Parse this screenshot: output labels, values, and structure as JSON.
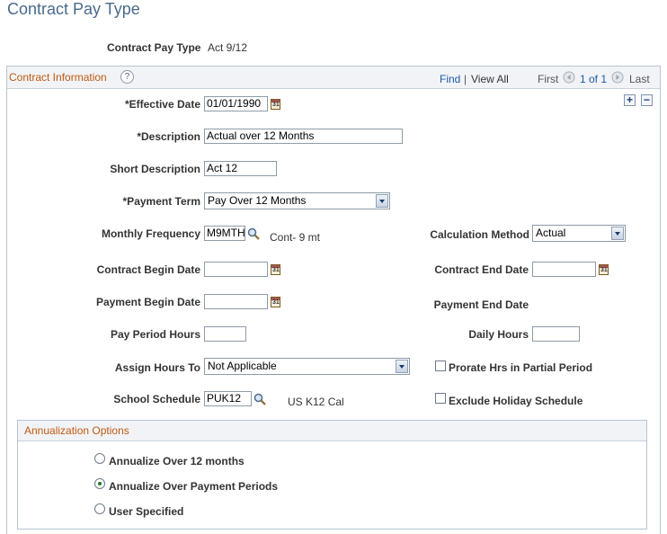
{
  "page": {
    "title": "Contract Pay Type"
  },
  "header": {
    "label": "Contract Pay Type",
    "value": "Act 9/12"
  },
  "contract_info": {
    "title": "Contract Information",
    "find": "Find",
    "sep": "|",
    "view_all": "View All",
    "first": "First",
    "range": "1 of 1",
    "last": "Last",
    "add": "+",
    "remove": "−"
  },
  "fields": {
    "effective_date": {
      "label": "*Effective Date",
      "value": "01/01/1990"
    },
    "description": {
      "label": "*Description",
      "value": "Actual over 12 Months"
    },
    "short_description": {
      "label": "Short Description",
      "value": "Act 12"
    },
    "payment_term": {
      "label": "*Payment Term",
      "value": "Pay Over 12 Months"
    },
    "monthly_frequency": {
      "label": "Monthly Frequency",
      "value": "M9MTH",
      "desc": "Cont- 9 mt"
    },
    "calculation_method": {
      "label": "Calculation Method",
      "value": "Actual"
    },
    "contract_begin_date": {
      "label": "Contract Begin Date",
      "value": ""
    },
    "contract_end_date": {
      "label": "Contract End Date",
      "value": ""
    },
    "payment_begin_date": {
      "label": "Payment Begin Date",
      "value": ""
    },
    "payment_end_date": {
      "label": "Payment End Date"
    },
    "pay_period_hours": {
      "label": "Pay Period Hours",
      "value": ""
    },
    "daily_hours": {
      "label": "Daily Hours",
      "value": ""
    },
    "assign_hours_to": {
      "label": "Assign Hours To",
      "value": "Not Applicable"
    },
    "prorate": {
      "label": "Prorate Hrs in Partial Period",
      "checked": false
    },
    "school_schedule": {
      "label": "School Schedule",
      "value": "PUK12",
      "desc": "US K12 Cal"
    },
    "exclude_holiday": {
      "label": "Exclude Holiday Schedule",
      "checked": false
    }
  },
  "annualization": {
    "title": "Annualization Options",
    "options": [
      {
        "label": "Annualize Over 12 months",
        "selected": false
      },
      {
        "label": "Annualize Over Payment Periods",
        "selected": true
      },
      {
        "label": "User Specified",
        "selected": false
      }
    ]
  }
}
